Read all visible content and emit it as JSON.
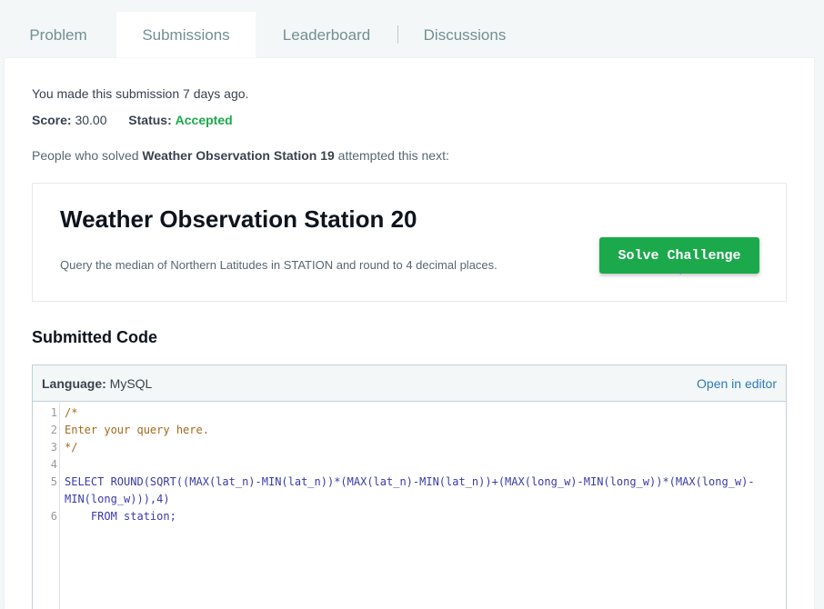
{
  "tabs": [
    {
      "label": "Problem"
    },
    {
      "label": "Submissions"
    },
    {
      "label": "Leaderboard"
    },
    {
      "label": "Discussions"
    }
  ],
  "submission": {
    "made_text": "You made this submission 7 days ago.",
    "score_label": "Score:",
    "score_value": "30.00",
    "status_label": "Status:",
    "status_value": "Accepted"
  },
  "next": {
    "prefix": "People who solved ",
    "solved_title": "Weather Observation Station 19",
    "suffix": " attempted this next:",
    "card_title": "Weather Observation Station 20",
    "card_desc": "Query the median of Northern Latitudes in STATION and round to 4 decimal places.",
    "solve_button": "Solve Challenge"
  },
  "code_section": {
    "title": "Submitted Code",
    "language_label": "Language:",
    "language_value": "MySQL",
    "open_editor": "Open in editor",
    "line_numbers": [
      "1",
      "2",
      "3",
      "4",
      "5",
      "6"
    ],
    "lines": [
      "/*",
      "Enter your query here.",
      "*/",
      "",
      "SELECT ROUND(SQRT((MAX(lat_n)-MIN(lat_n))*(MAX(lat_n)-MIN(lat_n))+(MAX(long_w)-MIN(long_w))*(MAX(long_w)-",
      "MIN(long_w))),4)",
      "    FROM station;"
    ]
  },
  "colors": {
    "accent_green": "#1ba94c",
    "link_blue": "#2f7ab7"
  }
}
